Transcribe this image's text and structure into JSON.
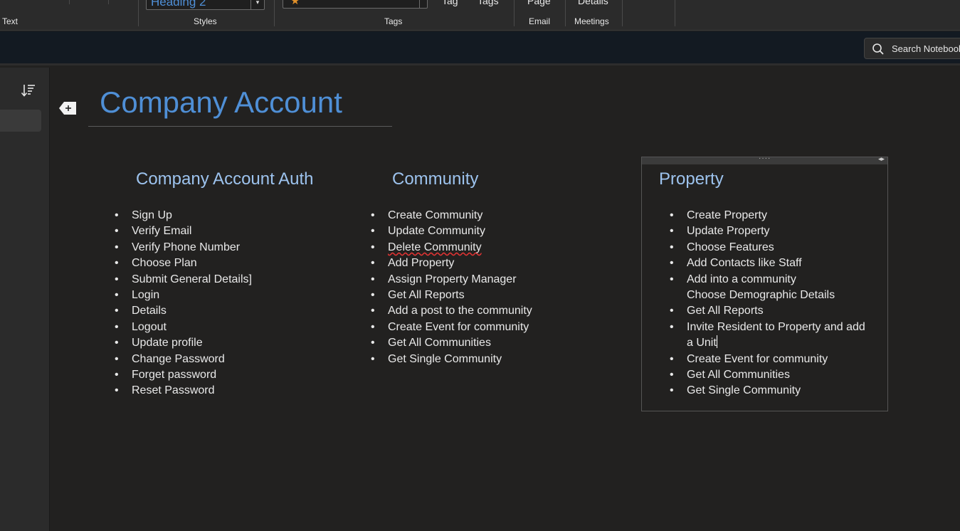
{
  "ribbon": {
    "groups": {
      "text": "Text",
      "styles": "Styles",
      "tags": "Tags",
      "email": "Email",
      "meetings": "Meetings"
    },
    "style_value": "Heading 2",
    "clipped_buttons": {
      "tag": "Tag",
      "tags": "Tags",
      "page": "Page",
      "details": "Details"
    }
  },
  "search": {
    "placeholder": "Search Notebooks"
  },
  "page": {
    "title": "Company Account",
    "columns": {
      "auth": {
        "heading": "Company Account Auth",
        "items": [
          "Sign Up",
          "Verify Email",
          "Verify Phone Number",
          "Choose Plan",
          "Submit General Details]",
          "Login",
          "Details",
          "Logout",
          "Update profile",
          "Change Password",
          "Forget password",
          "Reset Password"
        ]
      },
      "community": {
        "heading": "Community",
        "items": [
          "Create Community",
          "Update Community",
          "Delete Community",
          "Add Property",
          "Assign Property Manager",
          "Get All Reports",
          "Add a post to the community",
          "Create Event for community",
          "Get All Communities",
          "Get Single Community"
        ]
      },
      "property": {
        "heading": "Property",
        "items": [
          "Create Property",
          "Update Property",
          "Choose Features",
          "Add Contacts like Staff",
          "Add into a community",
          "Choose Demographic Details",
          "Get All Reports",
          "Invite Resident to Property and add",
          "a Unit",
          "Create Event for community",
          "Get All Communities",
          "Get Single Community"
        ]
      }
    }
  },
  "colors": {
    "accent": "#4f8fd6",
    "heading": "#9dc3ee",
    "background": "#222120"
  },
  "icons": [
    "search-icon",
    "sort-icon",
    "add-tag-icon",
    "star-icon",
    "move-handle-icon"
  ]
}
